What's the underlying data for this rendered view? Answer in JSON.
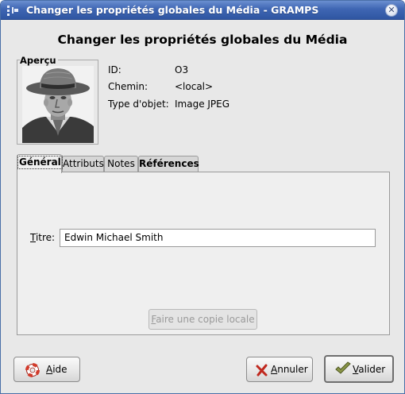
{
  "window": {
    "title": "Changer les propriétés globales du Média - GRAMPS"
  },
  "dialog": {
    "heading": "Changer les propriétés globales du Média"
  },
  "preview": {
    "label": "Aperçu"
  },
  "info": {
    "id_label": "ID:",
    "id_value": "O3",
    "path_label": "Chemin:",
    "path_value": "<local>",
    "type_label": "Type d'objet:",
    "type_value": "Image JPEG"
  },
  "tabs": [
    {
      "label": "Général",
      "active": true
    },
    {
      "label": "Attributs",
      "active": false
    },
    {
      "label": "Notes",
      "active": false
    },
    {
      "label": "Références",
      "active": false
    }
  ],
  "general": {
    "title_label_mnemonic": "T",
    "title_label_rest": "itre:",
    "title_value": "Edwin Michael Smith",
    "copy_button_mnemonic": "F",
    "copy_button_rest": "aire une copie locale"
  },
  "buttons": {
    "help_mnemonic": "A",
    "help_rest": "ide",
    "cancel_mnemonic": "A",
    "cancel_rest": "nnuler",
    "ok_mnemonic": "V",
    "ok_rest": "alider"
  },
  "icons": {
    "window_menu": "window-menu-icon",
    "close": "close-icon",
    "help": "help-lifebuoy-icon",
    "cancel": "cancel-x-icon",
    "ok": "ok-checkmark-icon"
  },
  "colors": {
    "titlebar": "#3f66b3",
    "cancel_icon": "#c0281e",
    "help_icon": "#d23a2a",
    "ok_icon": "#6e7a3a"
  }
}
